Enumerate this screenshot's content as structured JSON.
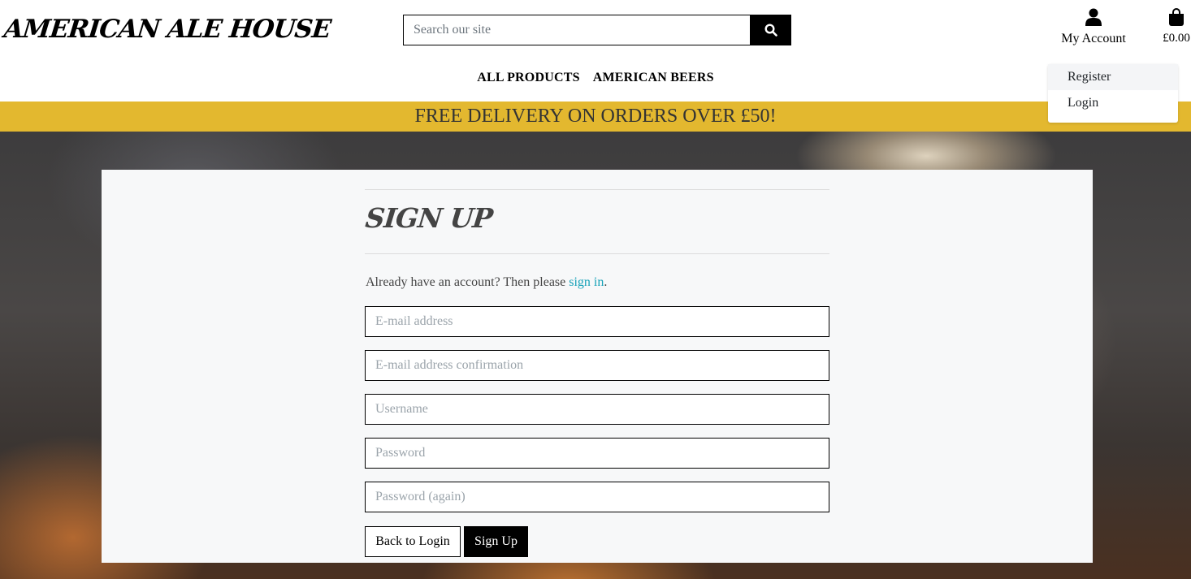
{
  "brand": {
    "logo_text": "AMERICAN ALE HOUSE"
  },
  "search": {
    "placeholder": "Search our site",
    "icon": "search-icon"
  },
  "account": {
    "label": "My Account",
    "icon": "user-icon"
  },
  "cart": {
    "total": "£0.00",
    "icon": "shopping-bag-icon"
  },
  "account_menu": {
    "items": [
      {
        "label": "Register"
      },
      {
        "label": "Login"
      }
    ]
  },
  "nav": {
    "items": [
      {
        "label": "ALL PRODUCTS"
      },
      {
        "label": "AMERICAN BEERS"
      }
    ]
  },
  "banner": {
    "text": "FREE DELIVERY ON ORDERS OVER £50!",
    "color": "#e3b82f"
  },
  "signup": {
    "title": "SIGN UP",
    "intro_prefix": "Already have an account? Then please ",
    "intro_link": "sign in",
    "intro_suffix": ".",
    "fields": {
      "email": "E-mail address",
      "email_confirm": "E-mail address confirmation",
      "username": "Username",
      "password": "Password",
      "password_again": "Password (again)"
    },
    "back_button": "Back to Login",
    "submit_button": "Sign Up"
  },
  "colors": {
    "link": "#17a2b8",
    "card_bg": "#f7f8f9"
  }
}
